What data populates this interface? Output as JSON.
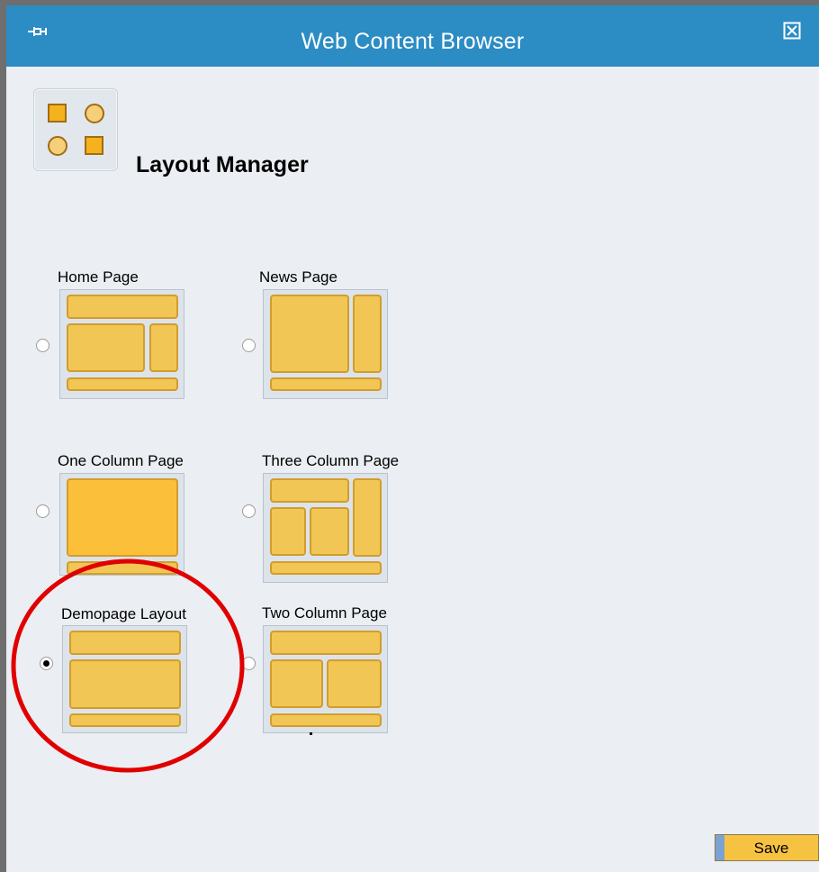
{
  "window": {
    "title": "Web Content Browser"
  },
  "header": {
    "title": "Layout Manager",
    "icon": "layout-manager-icon"
  },
  "colors": {
    "titlebar": "#2c8cc4",
    "block": "#f2c655",
    "block_border": "#d19d2c",
    "selected_highlight": "#e00000"
  },
  "layouts": [
    {
      "label": "Home Page",
      "selected": false
    },
    {
      "label": "News Page",
      "selected": false
    },
    {
      "label": "One Column Page",
      "selected": false
    },
    {
      "label": "Three Column Page",
      "selected": false
    },
    {
      "label": "Demopage Layout",
      "selected": true
    },
    {
      "label": "Two Column Page",
      "selected": false
    }
  ],
  "actions": {
    "save_label": "Save"
  }
}
